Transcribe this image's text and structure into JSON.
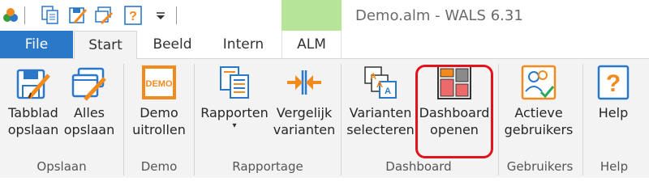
{
  "window": {
    "title": "Demo.alm - WALS 6.31"
  },
  "qat": {
    "items": [
      "app-logo-icon",
      "copy-doc-icon",
      "save-edit-icon",
      "windows-edit-icon",
      "help-icon",
      "customize-dropdown-icon"
    ]
  },
  "tabs": {
    "file": "File",
    "start": "Start",
    "beeld": "Beeld",
    "intern": "Intern",
    "alm": "ALM"
  },
  "ribbon": {
    "buttons": {
      "tabblad_opslaan": {
        "line1": "Tabblad",
        "line2": "opslaan"
      },
      "alles_opslaan": {
        "line1": "Alles",
        "line2": "opslaan"
      },
      "demo_uitrollen": {
        "line1": "Demo",
        "line2": "uitrollen",
        "icon_text": "DEMO"
      },
      "rapporten": {
        "line1": "Rapporten",
        "caret": "▾"
      },
      "vergelijk": {
        "line1": "Vergelijk",
        "line2": "varianten"
      },
      "varianten_selecteren": {
        "line1": "Varianten",
        "line2": "selecteren"
      },
      "dashboard_openen": {
        "line1": "Dashboard",
        "line2": "openen"
      },
      "actieve_gebruikers": {
        "line1": "Actieve",
        "line2": "gebruikers"
      },
      "help": {
        "line1": "Help"
      }
    },
    "groups": {
      "opslaan": "Opslaan",
      "demo": "Demo",
      "rapportage": "Rapportage",
      "dashboard": "Dashboard",
      "gebruikers": "Gebruikers",
      "help": "Help"
    }
  },
  "colors": {
    "file_tab": "#2b78c8",
    "alm_context": "#b6e59a",
    "accent_orange": "#f28a1e",
    "highlight_red": "#e0141b"
  }
}
